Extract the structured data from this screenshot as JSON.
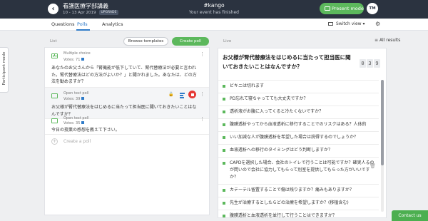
{
  "header": {
    "event_title": "看護医療学部講義",
    "event_dates": "10 - 13 Apr 2019",
    "upgrade_badge": "UPGRADE",
    "event_code": "#kango",
    "status": "Your event has finished",
    "present_label": "Present mode",
    "avatar_initials": "TM"
  },
  "tabs": [
    {
      "label": "Questions",
      "active": false
    },
    {
      "label": "Polls",
      "active": true
    },
    {
      "label": "Analytics",
      "active": false
    }
  ],
  "toolbar": {
    "switch_view_label": "Switch view ▾"
  },
  "side_tab": {
    "label": "Participant mode"
  },
  "list_panel": {
    "heading": "List",
    "browse_label": "Browse templates",
    "create_label": "Create poll",
    "polls": [
      {
        "type": "Multiple choice",
        "votes": "Votes: 71",
        "text": "あなたのお父さんから「腎機能が低下していて、腎代替療法が必要と言われた。腎代替療法はどの方法がよいか？」と聞かれました。あなたは、どの方法を勧めますか？",
        "active": false
      },
      {
        "type": "Open text poll",
        "votes": "Votes: 39",
        "text": "お父様が腎代替療法をはじめるに当たって担当医に聞いておきたいことはなんですか？",
        "active": true
      },
      {
        "type": "Open text poll",
        "votes": "Votes: 35",
        "text": "今日の授業の感想を教えて下さい。",
        "active": false
      }
    ],
    "create_placeholder": "Create a poll"
  },
  "live_panel": {
    "heading": "Live",
    "all_results_label": "All results",
    "question": "お父様が腎代替療法をはじめるに当たって担当医に聞いておきたいことはなんですか？",
    "counter_digits": [
      "0",
      "3",
      "9"
    ],
    "answers": [
      "ビキニは切れます",
      "PD忘れて寝ちゃってても大丈夫ですか？",
      "透析液がお腹に入ってくると冷たくないですか？",
      "腹膜透析やってから血液透析に移行することでのリスクはある？人体的",
      "いい加減な人が腹膜透析を希望した場合は説得するのでしょうか？",
      "血液透析への移行のタイミングはどう判断しますか？",
      "CAPDを選択した場合、会社のトイレで行うことは可能ですか？確実人るのが問いので会社に協力してもらって別室を提供してもらった方がいいですか？",
      "カテーテル留置することで傷は残りますか？痛みもありますか？",
      "先生が治療するとしたらどの治療を希望しますか？(移植含む)",
      "腹膜透析と血液透析を並行して行うことはできますか？"
    ]
  },
  "footer": {
    "contact_label": "Contact us"
  },
  "colors": {
    "accent": "#2f7bc8",
    "header_bg": "#2b3340",
    "success": "#5cb85c",
    "stop": "#e53935"
  }
}
